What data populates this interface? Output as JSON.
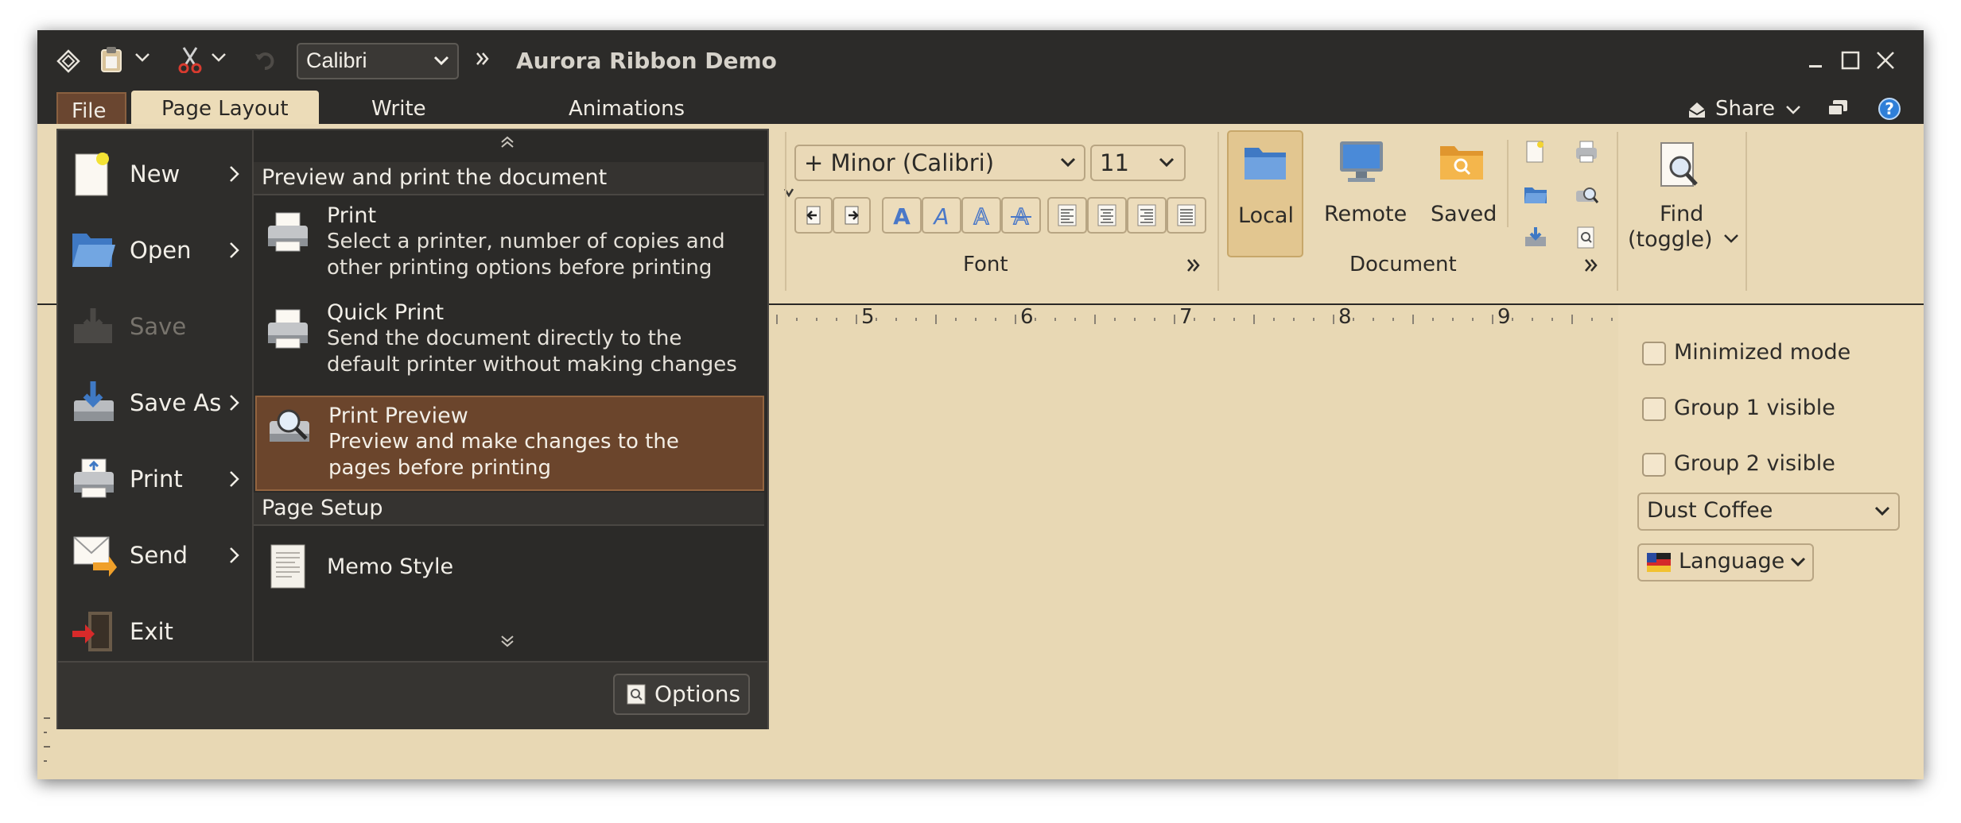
{
  "window": {
    "title": "Aurora Ribbon Demo",
    "font_combo": "Calibri"
  },
  "tabs": {
    "file": "File",
    "page_layout": "Page Layout",
    "write": "Write",
    "animations": "Animations",
    "share": "Share"
  },
  "ribbon": {
    "font_name": "+ Minor (Calibri)",
    "font_size": "11",
    "font_group": "Font",
    "document_group": "Document",
    "local": "Local",
    "remote": "Remote",
    "saved": "Saved",
    "find_line1": "Find",
    "find_line2": "(toggle)"
  },
  "ruler": {
    "numbers": [
      "5",
      "6",
      "7",
      "8",
      "9"
    ]
  },
  "right_panel": {
    "minimized_mode": "Minimized mode",
    "group1": "Group 1 visible",
    "group2": "Group 2 visible",
    "skin": "Dust Coffee",
    "language": "Language"
  },
  "menu": {
    "left": {
      "new": "New",
      "open": "Open",
      "save": "Save",
      "save_as": "Save As",
      "print": "Print",
      "send": "Send",
      "exit": "Exit"
    },
    "section_preview": "Preview and print the document",
    "print_title": "Print",
    "print_desc1": "Select a printer, number of copies and",
    "print_desc2": "other printing options before printing",
    "quick_title": "Quick Print",
    "quick_desc1": "Send the document directly to the",
    "quick_desc2": "default printer without making changes",
    "preview_title": "Print Preview",
    "preview_desc1": "Preview and make changes to the",
    "preview_desc2": "pages before printing",
    "section_setup": "Page Setup",
    "memo": "Memo Style",
    "options": "Options"
  },
  "colors": {
    "titlebar": "#2c2b29",
    "ribbon": "#e9d9b6",
    "document": "#e8d8b4",
    "menu": "#2b2a28",
    "highlight": "#6b452c",
    "file_tab": "#6a4630",
    "active_tab": "#ecdcb8",
    "local_selected": "#e2c690"
  },
  "icons": [
    "app-icon",
    "paste-icon",
    "cut-icon",
    "undo-icon",
    "minimize-icon",
    "maximize-icon",
    "close-icon",
    "share-icon",
    "comments-icon",
    "help-icon",
    "folder-icon",
    "monitor-icon",
    "saved-folder-icon",
    "find-icon",
    "printer-icon",
    "preview-icon",
    "memo-icon",
    "options-icon",
    "flag-icon"
  ]
}
